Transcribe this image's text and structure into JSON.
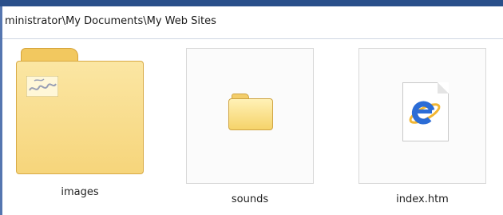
{
  "address": {
    "path": "ministrator\\My Documents\\My Web Sites"
  },
  "items": [
    {
      "name": "images",
      "icon": "folder-with-preview-icon"
    },
    {
      "name": "sounds",
      "icon": "folder-icon"
    },
    {
      "name": "index.htm",
      "icon": "internet-explorer-document-icon"
    }
  ],
  "colors": {
    "folder": "#f6d57b",
    "ie_blue": "#2b6cd6",
    "window_frame": "#2a4f8a"
  }
}
